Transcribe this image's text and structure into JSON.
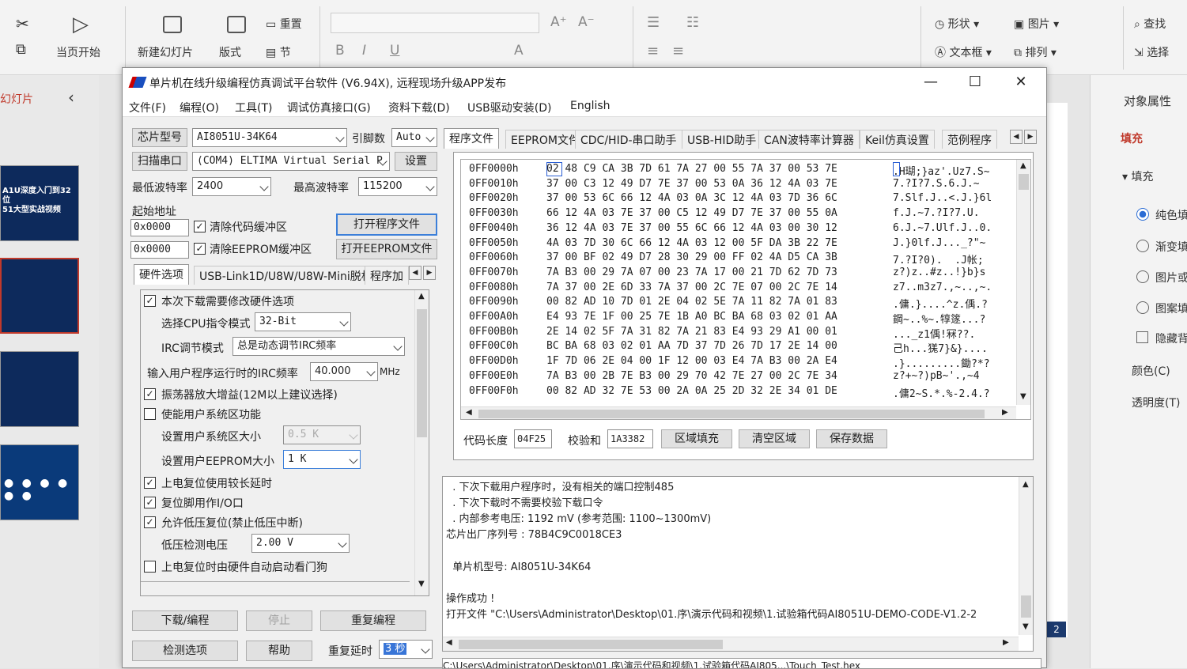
{
  "ppt": {
    "ribbon": {
      "start_from_current": "当页开始",
      "new_slide": "新建幻灯片",
      "layout": "版式",
      "reset": "重置",
      "section": "节",
      "shape": "形状",
      "picture": "图片",
      "textbox": "文本框",
      "arrange": "排列",
      "find": "查找",
      "select": "选择"
    },
    "left_pane": {
      "title": "幻灯片",
      "collapse": "‹"
    },
    "thumbs": [
      {
        "line1": "A1U深度入门到32位",
        "line2": "51大型实战视频"
      },
      {
        "line1": "",
        "line2": ""
      },
      {
        "line1": "",
        "line2": ""
      },
      {
        "line1": "",
        "line2": ""
      }
    ],
    "right_pane": {
      "title": "对象属性",
      "fill_tab": "填充",
      "fill_section": "填充",
      "opt_solid": "纯色填",
      "opt_gradient": "渐变填",
      "opt_picture": "图片或",
      "opt_pattern": "图案填",
      "opt_hide": "隐藏背",
      "color": "颜色(C)",
      "transparency": "透明度(T)"
    },
    "slide_number": "2"
  },
  "app": {
    "title": "单片机在线升级编程仿真调试平台软件 (V6.94X), 远程现场升级APP发布",
    "menu": [
      "文件(F)",
      "编程(O)",
      "工具(T)",
      "调试仿真接口(G)",
      "资料下载(D)",
      "USB驱动安装(D)",
      "English"
    ],
    "chip_model_btn": "芯片型号",
    "chip_model": "AI8051U-34K64",
    "pin_count_label": "引脚数",
    "pin_count": "Auto",
    "scan_port_btn": "扫描串口",
    "port": "(COM4) ELTIMA Virtual Serial P",
    "settings_btn": "设置",
    "min_baud_label": "最低波特率",
    "min_baud": "2400",
    "max_baud_label": "最高波特率",
    "max_baud": "115200",
    "start_addr_label": "起始地址",
    "addr1": "0x0000",
    "addr2": "0x0000",
    "clear_code_buf": "清除代码缓冲区",
    "clear_eeprom_buf": "清除EEPROM缓冲区",
    "open_prog_btn": "打开程序文件",
    "open_eeprom_btn": "打开EEPROM文件",
    "left_tabs": [
      "硬件选项",
      "USB-Link1D/U8W/U8W-Mini脱机",
      "程序加"
    ],
    "hw": {
      "modify_hw": "本次下载需要修改硬件选项",
      "cpu_mode_label": "选择CPU指令模式",
      "cpu_mode": "32-Bit",
      "irc_mode_label": "IRC调节模式",
      "irc_mode": "总是动态调节IRC频率",
      "irc_freq_label": "输入用户程序运行时的IRC频率",
      "irc_freq": "40.000",
      "irc_unit": "MHz",
      "osc_gain": "振荡器放大增益(12M以上建议选择)",
      "user_sys_area": "使能用户系统区功能",
      "user_sys_size_label": "设置用户系统区大小",
      "user_sys_size": "0.5  K",
      "user_eeprom_label": "设置用户EEPROM大小",
      "user_eeprom": "1   K",
      "long_reset": "上电复位使用较长延时",
      "reset_pin_io": "复位脚用作I/O口",
      "low_volt_reset": "允许低压复位(禁止低压中断)",
      "low_volt_label": "低压检测电压",
      "low_volt": "2.00  V",
      "watchdog": "上电复位时由硬件自动启动看门狗"
    },
    "download_btn": "下载/编程",
    "stop_btn": "停止",
    "reprogram_btn": "重复编程",
    "detect_btn": "检测选项",
    "help_btn": "帮助",
    "repeat_delay_label": "重复延时",
    "repeat_delay": "3 秒",
    "right_tabs": [
      "程序文件",
      "EEPROM文件",
      "CDC/HID-串口助手",
      "USB-HID助手",
      "CAN波特率计算器",
      "Keil仿真设置",
      "范例程序"
    ],
    "hex_rows": [
      {
        "addr": "0FF0000h",
        "bytes": "02 48 C9 CA 3B 7D 61 7A 27 00 55 7A 37 00 53 7E",
        "ascii": ".H瑚;}az'.Uz7.S~"
      },
      {
        "addr": "0FF0010h",
        "bytes": "37 00 C3 12 49 D7 7E 37 00 53 0A 36 12 4A 03 7E",
        "ascii": "7.?I?7.S.6.J.~"
      },
      {
        "addr": "0FF0020h",
        "bytes": "37 00 53 6C 66 12 4A 03 0A 3C 12 4A 03 7D 36 6C",
        "ascii": "7.Slf.J..<.J.}6l"
      },
      {
        "addr": "0FF0030h",
        "bytes": "66 12 4A 03 7E 37 00 C5 12 49 D7 7E 37 00 55 0A",
        "ascii": "f.J.~7.?I?7.U."
      },
      {
        "addr": "0FF0040h",
        "bytes": "36 12 4A 03 7E 37 00 55 6C 66 12 4A 03 00 30 12",
        "ascii": "6.J.~7.Ulf.J..0."
      },
      {
        "addr": "0FF0050h",
        "bytes": "4A 03 7D 30 6C 66 12 4A 03 12 00 5F DA 3B 22 7E",
        "ascii": "J.}0lf.J..._?\"~"
      },
      {
        "addr": "0FF0060h",
        "bytes": "37 00 BF 02 49 D7 28 30 29 00 FF 02 4A D5 CA 3B",
        "ascii": "7.?I?0).  .J帐;"
      },
      {
        "addr": "0FF0070h",
        "bytes": "7A B3 00 29 7A 07 00 23 7A 17 00 21 7D 62 7D 73",
        "ascii": "z?)z..#z..!}b}s"
      },
      {
        "addr": "0FF0080h",
        "bytes": "7A 37 00 2E 6D 33 7A 37 00 2C 7E 07 00 2C 7E 14",
        "ascii": "z7..m3z7.,~..,~."
      },
      {
        "addr": "0FF0090h",
        "bytes": "00 82 AD 10 7D 01 2E 04 02 5E 7A 11 82 7A 01 83",
        "ascii": ".傭.}....^z.偊.?"
      },
      {
        "addr": "0FF00A0h",
        "bytes": "E4 93 7E 1F 00 25 7E 1B A0 BC BA 68 03 02 01 AA",
        "ascii": "鋼~..%~.犉篴...?"
      },
      {
        "addr": "0FF00B0h",
        "bytes": "2E 14 02 5F 7A 31 82 7A 21 83 E4 93 29 A1 00 01",
        "ascii": "..._z1偊!冧??."
      },
      {
        "addr": "0FF00C0h",
        "bytes": "BC BA 68 03 02 01 AA 7D 37 7D 26 7D 17 2E 14 00",
        "ascii": "己h...獇7}&}...."
      },
      {
        "addr": "0FF00D0h",
        "bytes": "1F 7D 06 2E 04 00 1F 12 00 03 E4 7A B3 00 2A E4",
        "ascii": ".}.........鋤?*?"
      },
      {
        "addr": "0FF00E0h",
        "bytes": "7A B3 00 2B 7E B3 00 29 70 42 7E 27 00 2C 7E 34",
        "ascii": "z?+~?)pB~'.,~4"
      },
      {
        "addr": "0FF00F0h",
        "bytes": "00 82 AD 32 7E 53 00 2A 0A 25 2D 32 2E 34 01 DE",
        "ascii": ".傭2~S.*.%-2.4.?"
      }
    ],
    "code_len_label": "代码长度",
    "code_len": "04F25",
    "checksum_label": "校验和",
    "checksum": "1A3382",
    "fill_area_btn": "区域填充",
    "clear_area_btn": "清空区域",
    "save_data_btn": "保存数据",
    "log_lines": [
      "  . 下次下载用户程序时，没有相关的端口控制485",
      "  . 下次下载时不需要校验下载口令",
      "  . 内部参考电压: 1192 mV (参考范围: 1100~1300mV)",
      "芯片出厂序列号 : 78B4C9C0018CE3",
      "",
      "  单片机型号: AI8051U-34K64",
      "",
      "操作成功 !",
      "打开文件 \"C:\\Users\\Administrator\\Desktop\\01.序\\演示代码和视频\\1.试验箱代码AI8051U-DEMO-CODE-V1.2-2"
    ],
    "status_text": "C:\\Users\\Administrator\\Desktop\\01.序\\演示代码和视频\\1.试验箱代码AI805...\\Touch_Test.hex"
  }
}
